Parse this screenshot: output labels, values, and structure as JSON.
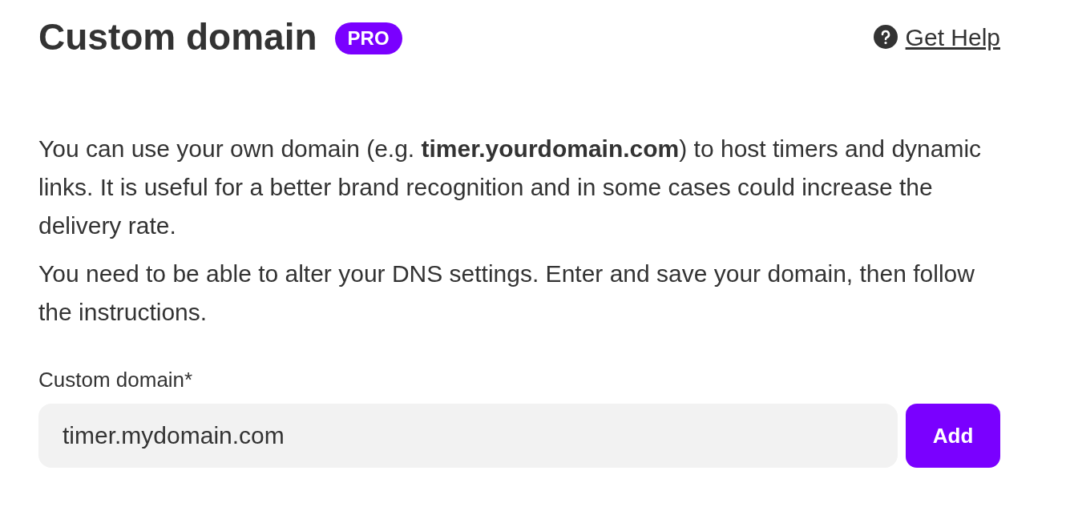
{
  "header": {
    "title": "Custom domain",
    "badge": "PRO",
    "help_link": "Get Help"
  },
  "paragraphs": [
    "You can use your own domain (e.g. **timer.yourdomain.com**) to host timers and dynamic links. It is useful for a better brand recognition and in some cases could increase the delivery rate.",
    "You need to be able to alter your DNS settings. Enter and save your domain, then follow the instructions."
  ],
  "field": {
    "label": "Custom domain*",
    "value": "timer.mydomain.com"
  },
  "buttons": [
    "Add"
  ]
}
